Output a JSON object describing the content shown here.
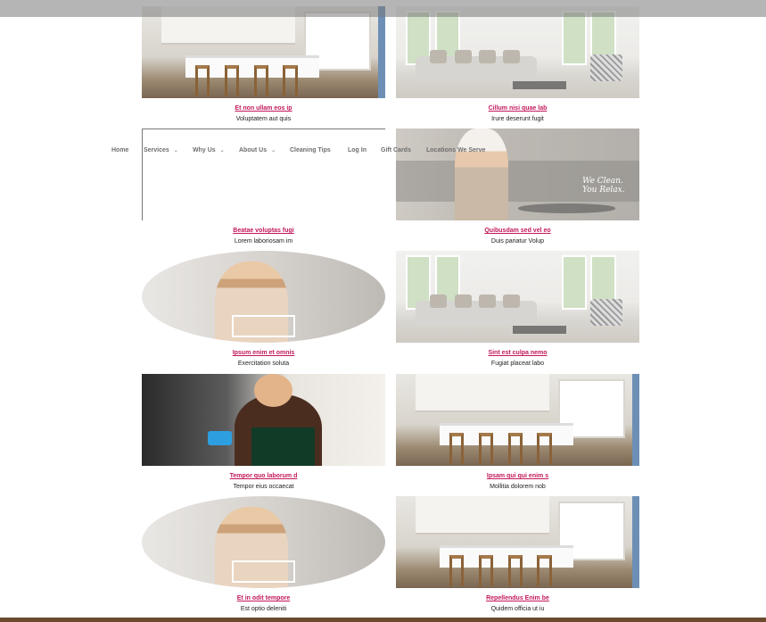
{
  "nav": {
    "items": [
      {
        "label": "Home",
        "has_dropdown": false
      },
      {
        "label": "Services",
        "has_dropdown": true
      },
      {
        "label": "Why Us",
        "has_dropdown": true
      },
      {
        "label": "About Us",
        "has_dropdown": true
      },
      {
        "label": "Cleaning Tips",
        "has_dropdown": false
      },
      {
        "label": "Log In",
        "has_dropdown": false
      },
      {
        "label": "Gift Cards",
        "has_dropdown": false
      },
      {
        "label": "Locations We Serve",
        "has_dropdown": false
      }
    ],
    "dropdown_glyph": "⌄"
  },
  "cards": [
    {
      "image": "kitchen",
      "title": "Et non ullam eos ip",
      "subtitle": "Voluptatem aut quis"
    },
    {
      "image": "living-room",
      "title": "Cillum nisi quae lab",
      "subtitle": "Irure deserunt fugit"
    },
    {
      "image": "blank",
      "title": "Beatae voluptas fugi",
      "subtitle": "Lorem laboriosam im"
    },
    {
      "image": "spa-relax",
      "title": "Quibusdam sed vel eo",
      "subtitle": "Duis pariatur Volup",
      "overlay_text": [
        "We Clean.",
        "You Relax."
      ]
    },
    {
      "image": "cleaner-laptop",
      "title": "Ipsum enim et omnis",
      "subtitle": "Exercitation soluta"
    },
    {
      "image": "living-room",
      "title": "Sint est culpa nemo",
      "subtitle": "Fugiat placeat labo"
    },
    {
      "image": "maid-spraying",
      "title": "Tempor quo laborum d",
      "subtitle": "Tempor eius occaecat"
    },
    {
      "image": "kitchen",
      "title": "Ipsam qui qui enim s",
      "subtitle": "Mollitia dolorem nob"
    },
    {
      "image": "cleaner-laptop",
      "title": "Et in odit tempore",
      "subtitle": "Est optio deleniti"
    },
    {
      "image": "kitchen",
      "title": "Repellendus Enim be",
      "subtitle": "Quidem officia ut iu"
    }
  ],
  "colors": {
    "accent_link": "#c2185b",
    "footer_bar": "#6b4a2e",
    "top_overlay": "#787878"
  }
}
